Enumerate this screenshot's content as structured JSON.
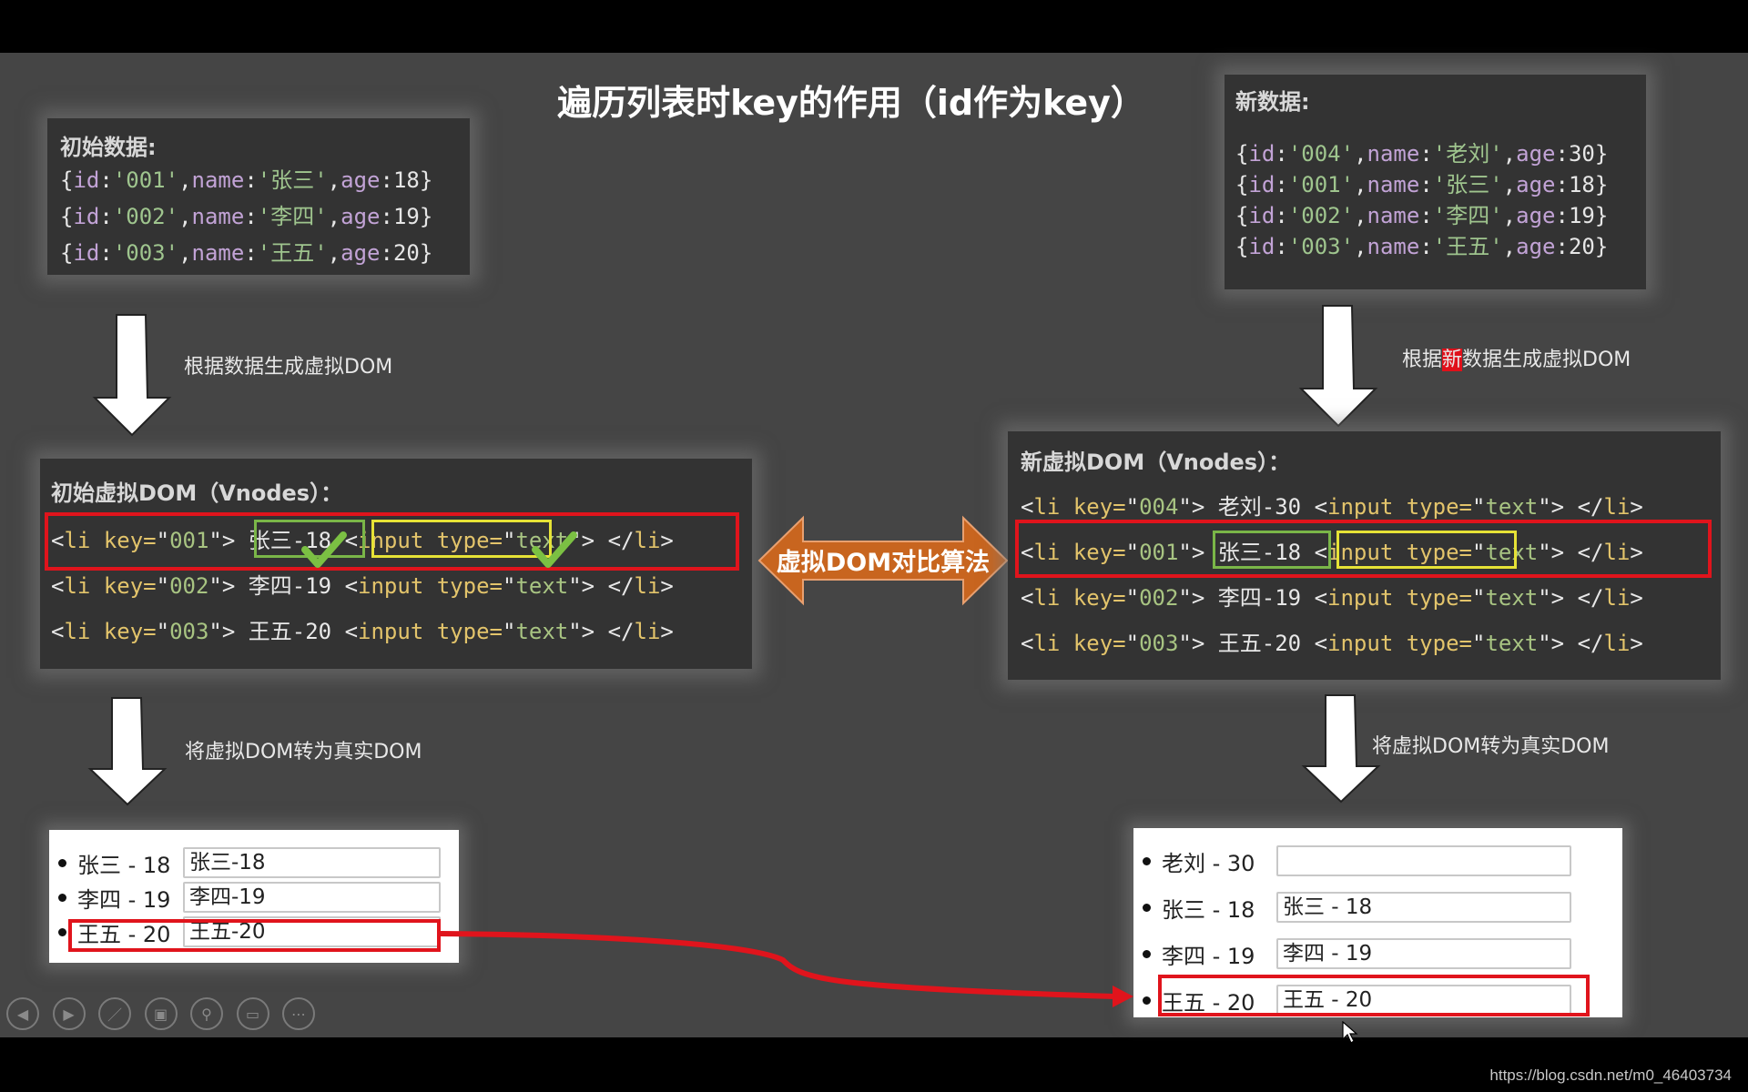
{
  "slide": {
    "title": "遍历列表时key的作用（id作为key）",
    "initial_data": {
      "header": "初始数据:",
      "rows": [
        {
          "id": "001",
          "name": "张三",
          "age": "18"
        },
        {
          "id": "002",
          "name": "李四",
          "age": "19"
        },
        {
          "id": "003",
          "name": "王五",
          "age": "20"
        }
      ]
    },
    "new_data": {
      "header": "新数据:",
      "rows": [
        {
          "id": "004",
          "name": "老刘",
          "age": "30"
        },
        {
          "id": "001",
          "name": "张三",
          "age": "18"
        },
        {
          "id": "002",
          "name": "李四",
          "age": "19"
        },
        {
          "id": "003",
          "name": "王五",
          "age": "20"
        }
      ]
    },
    "code_tokens": {
      "lbrace": "{",
      "rbrace": "}",
      "id_key": "id:",
      "name_key": ",name:",
      "age_key": ",age:",
      "quote": "'",
      "li_open": "<li ",
      "key_attr": "key=",
      "dq": "\"",
      "gt": ">",
      "input_tag": "<input ",
      "type_attr": "type=",
      "text_val": "text",
      "li_close": "</li>",
      "dash": "-"
    },
    "step_labels": {
      "left_generate": "根据数据生成虚拟DOM",
      "right_generate_prefix": "根据",
      "right_generate_highlight": "新",
      "right_generate_suffix": "数据生成虚拟DOM",
      "left_render": "将虚拟DOM转为真实DOM",
      "right_render": "将虚拟DOM转为真实DOM"
    },
    "initial_vdom": {
      "header": "初始虚拟DOM（Vnodes）：",
      "rows": [
        {
          "key": "001",
          "text": "张三-18"
        },
        {
          "key": "002",
          "text": "李四-19"
        },
        {
          "key": "003",
          "text": "王五-20"
        }
      ]
    },
    "new_vdom": {
      "header": "新虚拟DOM（Vnodes）：",
      "rows": [
        {
          "key": "004",
          "text": "老刘-30"
        },
        {
          "key": "001",
          "text": "张三-18"
        },
        {
          "key": "002",
          "text": "李四-19"
        },
        {
          "key": "003",
          "text": "王五-20"
        }
      ]
    },
    "diff_label": "虚拟DOM对比算法",
    "initial_real_dom": [
      {
        "label": "张三 - 18",
        "input_value": "张三-18"
      },
      {
        "label": "李四 - 19",
        "input_value": "李四-19"
      },
      {
        "label": "王五 - 20",
        "input_value": "王五-20"
      }
    ],
    "new_real_dom": [
      {
        "label": "老刘 - 30",
        "input_value": ""
      },
      {
        "label": "张三 - 18",
        "input_value": "张三 - 18"
      },
      {
        "label": "李四 - 19",
        "input_value": "李四 - 19"
      },
      {
        "label": "王五 - 20",
        "input_value": "王五 - 20"
      }
    ],
    "colors": {
      "highlight_red": "#e0141c",
      "highlight_green": "#7ab648",
      "highlight_yellow": "#e6e236",
      "diff_arrow": "#c8651f"
    }
  },
  "toolbar": {
    "buttons": [
      {
        "name": "previous-slide",
        "icon": "◀"
      },
      {
        "name": "next-slide",
        "icon": "▶"
      },
      {
        "name": "pen",
        "icon": "／"
      },
      {
        "name": "see-all-slides",
        "icon": "▣"
      },
      {
        "name": "zoom",
        "icon": "⚲"
      },
      {
        "name": "subtitles",
        "icon": "▭"
      },
      {
        "name": "more-options",
        "icon": "⋯"
      }
    ]
  },
  "watermark": "https://blog.csdn.net/m0_46403734"
}
